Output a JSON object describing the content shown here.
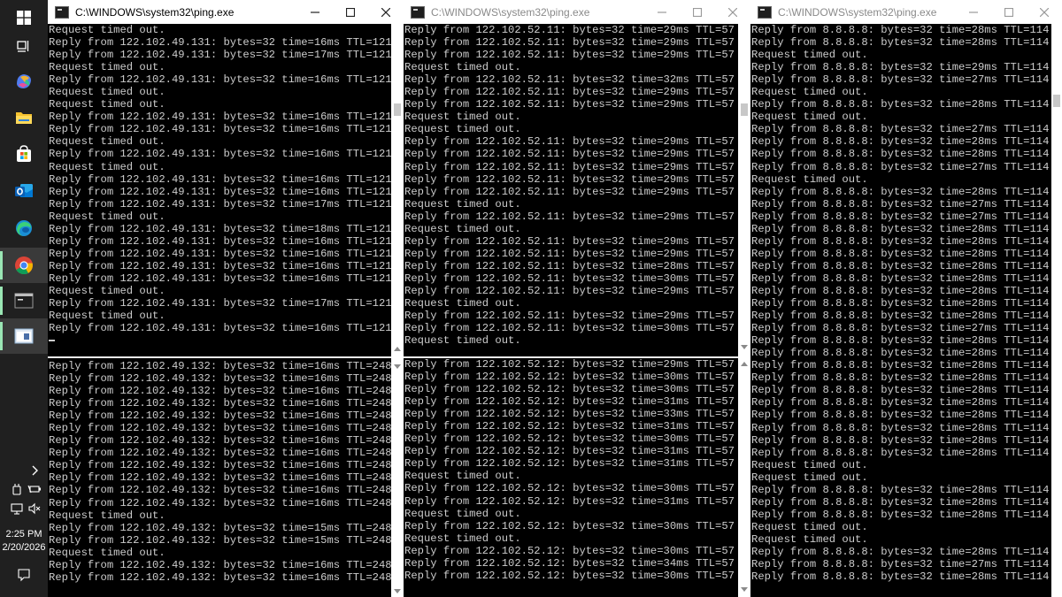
{
  "taskbar": {
    "time": "2:25 PM",
    "date": "2/20/2026"
  },
  "windows": [
    {
      "title": "C:\\WINDOWS\\system32\\ping.exe",
      "top_lines": [
        "Request timed out.",
        "Reply from 122.102.49.131: bytes=32 time=16ms TTL=121",
        "Reply from 122.102.49.131: bytes=32 time=17ms TTL=121",
        "Request timed out.",
        "Reply from 122.102.49.131: bytes=32 time=16ms TTL=121",
        "Request timed out.",
        "Request timed out.",
        "Reply from 122.102.49.131: bytes=32 time=16ms TTL=121",
        "Reply from 122.102.49.131: bytes=32 time=16ms TTL=121",
        "Request timed out.",
        "Reply from 122.102.49.131: bytes=32 time=16ms TTL=121",
        "Request timed out.",
        "Reply from 122.102.49.131: bytes=32 time=16ms TTL=121",
        "Reply from 122.102.49.131: bytes=32 time=16ms TTL=121",
        "Reply from 122.102.49.131: bytes=32 time=17ms TTL=121",
        "Request timed out.",
        "Reply from 122.102.49.131: bytes=32 time=18ms TTL=121",
        "Reply from 122.102.49.131: bytes=32 time=16ms TTL=121",
        "Reply from 122.102.49.131: bytes=32 time=16ms TTL=121",
        "Reply from 122.102.49.131: bytes=32 time=16ms TTL=121",
        "Reply from 122.102.49.131: bytes=32 time=16ms TTL=121",
        "Request timed out.",
        "Reply from 122.102.49.131: bytes=32 time=17ms TTL=121",
        "Request timed out.",
        "Reply from 122.102.49.131: bytes=32 time=16ms TTL=121"
      ],
      "bottom_lines": [
        "Reply from 122.102.49.132: bytes=32 time=16ms TTL=248",
        "Reply from 122.102.49.132: bytes=32 time=16ms TTL=248",
        "Reply from 122.102.49.132: bytes=32 time=16ms TTL=248",
        "Reply from 122.102.49.132: bytes=32 time=16ms TTL=248",
        "Reply from 122.102.49.132: bytes=32 time=16ms TTL=248",
        "Reply from 122.102.49.132: bytes=32 time=16ms TTL=248",
        "Reply from 122.102.49.132: bytes=32 time=16ms TTL=248",
        "Reply from 122.102.49.132: bytes=32 time=16ms TTL=248",
        "Reply from 122.102.49.132: bytes=32 time=16ms TTL=248",
        "Reply from 122.102.49.132: bytes=32 time=16ms TTL=248",
        "Reply from 122.102.49.132: bytes=32 time=16ms TTL=248",
        "Reply from 122.102.49.132: bytes=32 time=16ms TTL=248",
        "Request timed out.",
        "Reply from 122.102.49.132: bytes=32 time=15ms TTL=248",
        "Reply from 122.102.49.132: bytes=32 time=15ms TTL=248",
        "Request timed out.",
        "Reply from 122.102.49.132: bytes=32 time=16ms TTL=248",
        "Reply from 122.102.49.132: bytes=32 time=16ms TTL=248"
      ]
    },
    {
      "title": "C:\\WINDOWS\\system32\\ping.exe",
      "top_lines": [
        "Reply from 122.102.52.11: bytes=32 time=29ms TTL=57",
        "Reply from 122.102.52.11: bytes=32 time=29ms TTL=57",
        "Reply from 122.102.52.11: bytes=32 time=29ms TTL=57",
        "Request timed out.",
        "Reply from 122.102.52.11: bytes=32 time=32ms TTL=57",
        "Reply from 122.102.52.11: bytes=32 time=29ms TTL=57",
        "Reply from 122.102.52.11: bytes=32 time=29ms TTL=57",
        "Request timed out.",
        "Request timed out.",
        "Reply from 122.102.52.11: bytes=32 time=29ms TTL=57",
        "Reply from 122.102.52.11: bytes=32 time=29ms TTL=57",
        "Reply from 122.102.52.11: bytes=32 time=29ms TTL=57",
        "Reply from 122.102.52.11: bytes=32 time=29ms TTL=57",
        "Reply from 122.102.52.11: bytes=32 time=29ms TTL=57",
        "Request timed out.",
        "Reply from 122.102.52.11: bytes=32 time=29ms TTL=57",
        "Request timed out.",
        "Reply from 122.102.52.11: bytes=32 time=29ms TTL=57",
        "Reply from 122.102.52.11: bytes=32 time=29ms TTL=57",
        "Reply from 122.102.52.11: bytes=32 time=28ms TTL=57",
        "Reply from 122.102.52.11: bytes=32 time=30ms TTL=57",
        "Reply from 122.102.52.11: bytes=32 time=29ms TTL=57",
        "Request timed out.",
        "Reply from 122.102.52.11: bytes=32 time=29ms TTL=57",
        "Reply from 122.102.52.11: bytes=32 time=30ms TTL=57",
        "Request timed out."
      ],
      "bottom_lines": [
        "Reply from 122.102.52.12: bytes=32 time=29ms TTL=57",
        "Reply from 122.102.52.12: bytes=32 time=30ms TTL=57",
        "Reply from 122.102.52.12: bytes=32 time=30ms TTL=57",
        "Reply from 122.102.52.12: bytes=32 time=31ms TTL=57",
        "Reply from 122.102.52.12: bytes=32 time=33ms TTL=57",
        "Reply from 122.102.52.12: bytes=32 time=31ms TTL=57",
        "Reply from 122.102.52.12: bytes=32 time=30ms TTL=57",
        "Reply from 122.102.52.12: bytes=32 time=31ms TTL=57",
        "Reply from 122.102.52.12: bytes=32 time=31ms TTL=57",
        "Request timed out.",
        "Reply from 122.102.52.12: bytes=32 time=30ms TTL=57",
        "Reply from 122.102.52.12: bytes=32 time=31ms TTL=57",
        "Request timed out.",
        "Reply from 122.102.52.12: bytes=32 time=30ms TTL=57",
        "Request timed out.",
        "Reply from 122.102.52.12: bytes=32 time=30ms TTL=57",
        "Reply from 122.102.52.12: bytes=32 time=34ms TTL=57",
        "Reply from 122.102.52.12: bytes=32 time=30ms TTL=57"
      ]
    },
    {
      "title": "C:\\WINDOWS\\system32\\ping.exe",
      "lines": [
        "Reply from 8.8.8.8: bytes=32 time=28ms TTL=114",
        "Reply from 8.8.8.8: bytes=32 time=28ms TTL=114",
        "Request timed out.",
        "Reply from 8.8.8.8: bytes=32 time=29ms TTL=114",
        "Reply from 8.8.8.8: bytes=32 time=27ms TTL=114",
        "Request timed out.",
        "Reply from 8.8.8.8: bytes=32 time=28ms TTL=114",
        "Request timed out.",
        "Reply from 8.8.8.8: bytes=32 time=27ms TTL=114",
        "Reply from 8.8.8.8: bytes=32 time=28ms TTL=114",
        "Reply from 8.8.8.8: bytes=32 time=28ms TTL=114",
        "Reply from 8.8.8.8: bytes=32 time=27ms TTL=114",
        "Request timed out.",
        "Reply from 8.8.8.8: bytes=32 time=28ms TTL=114",
        "Reply from 8.8.8.8: bytes=32 time=27ms TTL=114",
        "Reply from 8.8.8.8: bytes=32 time=27ms TTL=114",
        "Reply from 8.8.8.8: bytes=32 time=28ms TTL=114",
        "Reply from 8.8.8.8: bytes=32 time=28ms TTL=114",
        "Reply from 8.8.8.8: bytes=32 time=28ms TTL=114",
        "Reply from 8.8.8.8: bytes=32 time=28ms TTL=114",
        "Reply from 8.8.8.8: bytes=32 time=28ms TTL=114",
        "Reply from 8.8.8.8: bytes=32 time=28ms TTL=114",
        "Reply from 8.8.8.8: bytes=32 time=28ms TTL=114",
        "Reply from 8.8.8.8: bytes=32 time=28ms TTL=114",
        "Reply from 8.8.8.8: bytes=32 time=27ms TTL=114",
        "Reply from 8.8.8.8: bytes=32 time=28ms TTL=114",
        "Reply from 8.8.8.8: bytes=32 time=28ms TTL=114",
        "Reply from 8.8.8.8: bytes=32 time=28ms TTL=114",
        "Reply from 8.8.8.8: bytes=32 time=28ms TTL=114",
        "Reply from 8.8.8.8: bytes=32 time=28ms TTL=114",
        "Reply from 8.8.8.8: bytes=32 time=28ms TTL=114",
        "Reply from 8.8.8.8: bytes=32 time=28ms TTL=114",
        "Reply from 8.8.8.8: bytes=32 time=28ms TTL=114",
        "Reply from 8.8.8.8: bytes=32 time=28ms TTL=114",
        "Reply from 8.8.8.8: bytes=32 time=28ms TTL=114",
        "Request timed out.",
        "Request timed out.",
        "Reply from 8.8.8.8: bytes=32 time=28ms TTL=114",
        "Reply from 8.8.8.8: bytes=32 time=28ms TTL=114",
        "Reply from 8.8.8.8: bytes=32 time=28ms TTL=114",
        "Request timed out.",
        "Request timed out.",
        "Reply from 8.8.8.8: bytes=32 time=28ms TTL=114",
        "Reply from 8.8.8.8: bytes=32 time=27ms TTL=114",
        "Reply from 8.8.8.8: bytes=32 time=28ms TTL=114"
      ]
    }
  ],
  "icons": {
    "start": "windows-logo-icon",
    "task_view": "task-view-icon",
    "copilot": "copilot-icon",
    "explorer": "file-explorer-icon",
    "store": "store-icon",
    "outlook": "outlook-icon",
    "edge": "edge-icon",
    "chrome": "chrome-icon",
    "terminal": "command-prompt-icon",
    "active_app": "remote-desktop-icon"
  },
  "colors": {
    "console_bg": "#000000",
    "console_text": "#cccccc",
    "taskbar_bg": "#202020",
    "active_indicator": "#9ae6b4"
  }
}
